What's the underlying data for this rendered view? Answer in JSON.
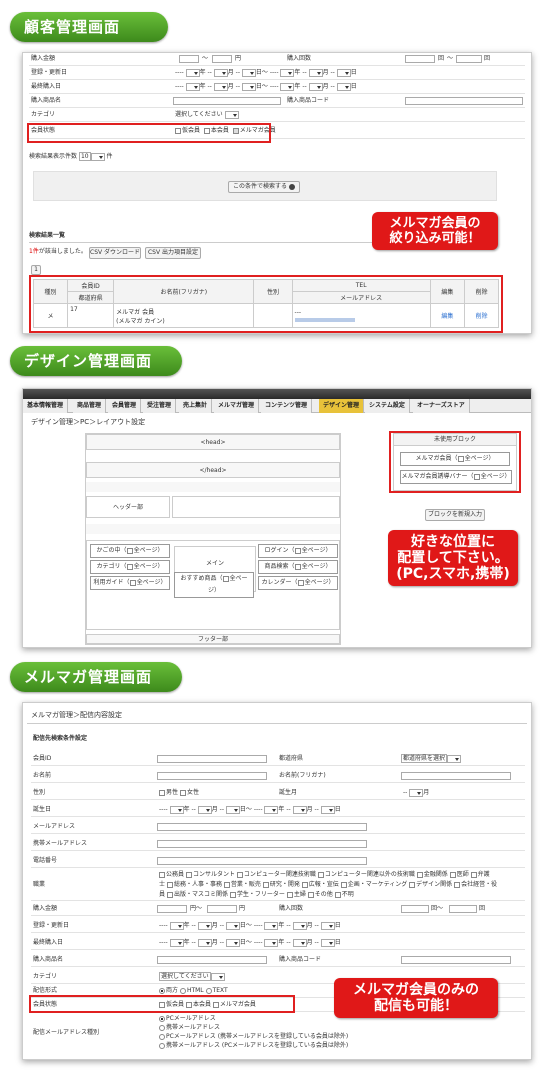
{
  "titles": {
    "customer": "顧客管理画面",
    "design": "デザイン管理画面",
    "mailmag": "メルマガ管理画面"
  },
  "customer": {
    "rows": {
      "amount": "購入金額",
      "yen": "円",
      "tilde": "〜",
      "count": "購入回数",
      "times": "回",
      "regdate": "登録・更新日",
      "lastdate": "最終購入日",
      "product": "購入商品名",
      "productcode": "購入商品コード",
      "category": "カテゴリ",
      "category_sel": "選択してください",
      "status": "会員状態",
      "status_opts": [
        "仮会員",
        "本会員",
        "メルマガ会員"
      ]
    },
    "date_seg": [
      "年",
      "月",
      "日〜",
      "年",
      "月",
      "日"
    ],
    "per_page_label": "検索結果表示件数",
    "per_page_value": "10",
    "per_page_unit": "件",
    "search_button": "この条件で検索する",
    "results_title": "検索結果一覧",
    "results_count": "1件",
    "results_text": "が該当しました。",
    "csv_download": "CSV ダウンロード",
    "csv_settings": "CSV 出力項目設定",
    "page_no": "1",
    "table_headers": [
      "種別",
      "会員ID",
      "都道府県",
      "お名前(フリガナ)",
      "性別",
      "TEL",
      "メールアドレス",
      "編集",
      "削除"
    ],
    "table_row": {
      "type": "メ",
      "id": "17",
      "name": "メルマガ 会員",
      "kana": "(メルマガ カイン)",
      "tel": "---",
      "edit": "編集",
      "delete": "削除"
    },
    "callout": [
      "メルマガ会員の",
      "絞り込み可能！"
    ]
  },
  "design": {
    "tabs": [
      "基本情報管理",
      "商品管理",
      "会員管理",
      "受注管理",
      "売上集計",
      "メルマガ管理",
      "コンテンツ管理",
      "デザイン管理",
      "システム設定",
      "オーナーズストア"
    ],
    "breadcrumb": "デザイン管理＞PC＞レイアウト設定",
    "head_open": "<head>",
    "head_close": "</head>",
    "header": "ヘッダー部",
    "main": "メイン",
    "footer": "フッター部",
    "left_blocks": [
      "かごの中",
      "カテゴリ",
      "利用ガイド"
    ],
    "center_block": "おすすめ商品",
    "right_blocks": [
      "ログイン",
      "商品検索",
      "カレンダー"
    ],
    "all_pages": "全ページ",
    "unused_title": "未使用ブロック",
    "unused_blocks": [
      "メルマガ会員",
      "メルマガ会員誘導バナー"
    ],
    "new_block": "ブロックを新規入力",
    "callout": [
      "好きな位置に",
      "配置して下さい。",
      "(PC,スマホ,携帯)"
    ]
  },
  "mailmag": {
    "breadcrumb": "メルマガ管理＞配信内容設定",
    "section": "配信先検索条件設定",
    "rows": {
      "member_id": "会員ID",
      "pref": "都道府県",
      "pref_sel": "都道府県を選択",
      "name": "お名前",
      "kana": "お名前(フリガナ)",
      "gender": "性別",
      "male": "男性",
      "female": "女性",
      "birth_month": "誕生月",
      "month": "月",
      "birthday": "誕生日",
      "email": "メールアドレス",
      "mobile_email": "携帯メールアドレス",
      "tel": "電話番号",
      "job": "職業",
      "amount": "購入金額",
      "count": "購入回数",
      "regdate": "登録・更新日",
      "lastdate": "最終購入日",
      "product": "購入商品名",
      "productcode": "購入商品コード",
      "category": "カテゴリ",
      "category_sel": "選択してください",
      "format": "配信形式",
      "format_opts": [
        "両方",
        "HTML",
        "TEXT"
      ],
      "status": "会員状態",
      "status_opts": [
        "仮会員",
        "本会員",
        "メルマガ会員"
      ],
      "addr_type": "配信メールアドレス種別",
      "addr_opts": [
        "PCメールアドレス",
        "携帯メールアドレス",
        "PCメールアドレス (携帯メールアドレスを登録している会員は除外)",
        "携帯メールアドレス (PCメールアドレスを登録している会員は除外)"
      ]
    },
    "jobs_line1": [
      "公務員",
      "コンサルタント",
      "コンピューター関連技術職",
      "コンピューター関連以外の技術職",
      "金融関係",
      "医師",
      "弁護"
    ],
    "jobs_line2a": "士",
    "jobs_line2": [
      "総務・人事・事務",
      "営業・販売",
      "研究・開発",
      "広報・宣伝",
      "企画・マーケティング",
      "デザイン関係",
      "会社経営・役"
    ],
    "jobs_line3a": "員",
    "jobs_line3": [
      "出版・マスコミ関係",
      "学生・フリーター",
      "主婦",
      "その他",
      "不明"
    ],
    "callout": [
      "メルマガ会員のみの",
      "配信も可能！"
    ]
  }
}
